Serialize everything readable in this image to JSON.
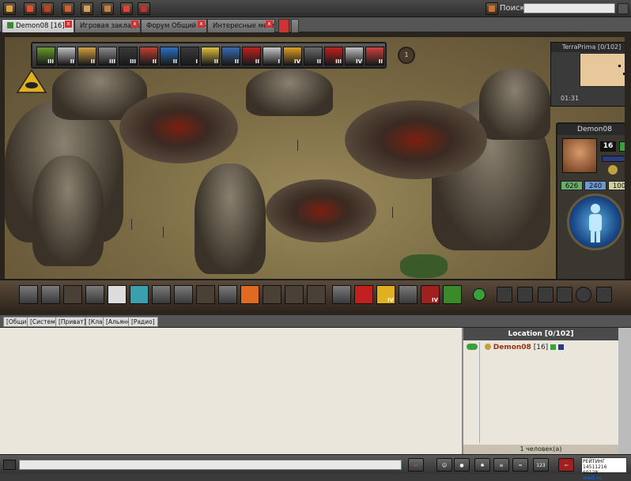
{
  "toolbar": {
    "search_label": "Поиск:",
    "search_value": "",
    "buttons": [
      "home-icon",
      "add-icon",
      "refresh-icon",
      "favorites-icon",
      "window-icon",
      "settings-icon",
      "game-icon",
      "bookmark-icon"
    ]
  },
  "tabs": [
    {
      "label": "Demon08 [16]",
      "active": true,
      "has_close": true
    },
    {
      "label": "Игровая закладка",
      "active": false,
      "has_close": true
    },
    {
      "label": "Форум Общий Онлай...",
      "active": false,
      "has_close": true
    },
    {
      "label": "Интересные места - ...",
      "active": false,
      "has_close": true
    }
  ],
  "game": {
    "skills": [
      {
        "level": "III"
      },
      {
        "level": "II"
      },
      {
        "level": "II"
      },
      {
        "level": "III"
      },
      {
        "level": "III"
      },
      {
        "level": "II"
      },
      {
        "level": "II"
      },
      {
        "level": "I"
      },
      {
        "level": "II"
      },
      {
        "level": "II"
      },
      {
        "level": "II"
      },
      {
        "level": "I"
      },
      {
        "level": "IV"
      },
      {
        "level": "II"
      },
      {
        "level": "III"
      },
      {
        "level": "IV"
      },
      {
        "level": "II"
      }
    ],
    "turn_counter": "1",
    "minimap": {
      "title": "TerraPrima [0/102]",
      "time": "01:31"
    },
    "character": {
      "name": "Demon08",
      "level": "16",
      "hp": "626",
      "mana": "240",
      "percent": "100"
    },
    "inventory_levels": [
      "IV",
      "IV"
    ]
  },
  "chat": {
    "tabs": [
      "[Общий]",
      "[Системки]",
      "[Приват]",
      "[Клан]",
      "[Альянс]",
      "[Радио]"
    ],
    "input_value": ""
  },
  "location": {
    "title": "Location [0/102]",
    "player_name": "Demon08",
    "player_level": "[16]",
    "count_text": "1 человек(а)"
  },
  "counter": {
    "brand": "mail.ru",
    "line1": "РЕЙТИНГ 14511216",
    "line2": "69128",
    "line3": "5646"
  },
  "colors": {
    "accent_red": "#a03010",
    "panel_dark": "#2a241e",
    "chat_bg": "#ebe6dc"
  }
}
